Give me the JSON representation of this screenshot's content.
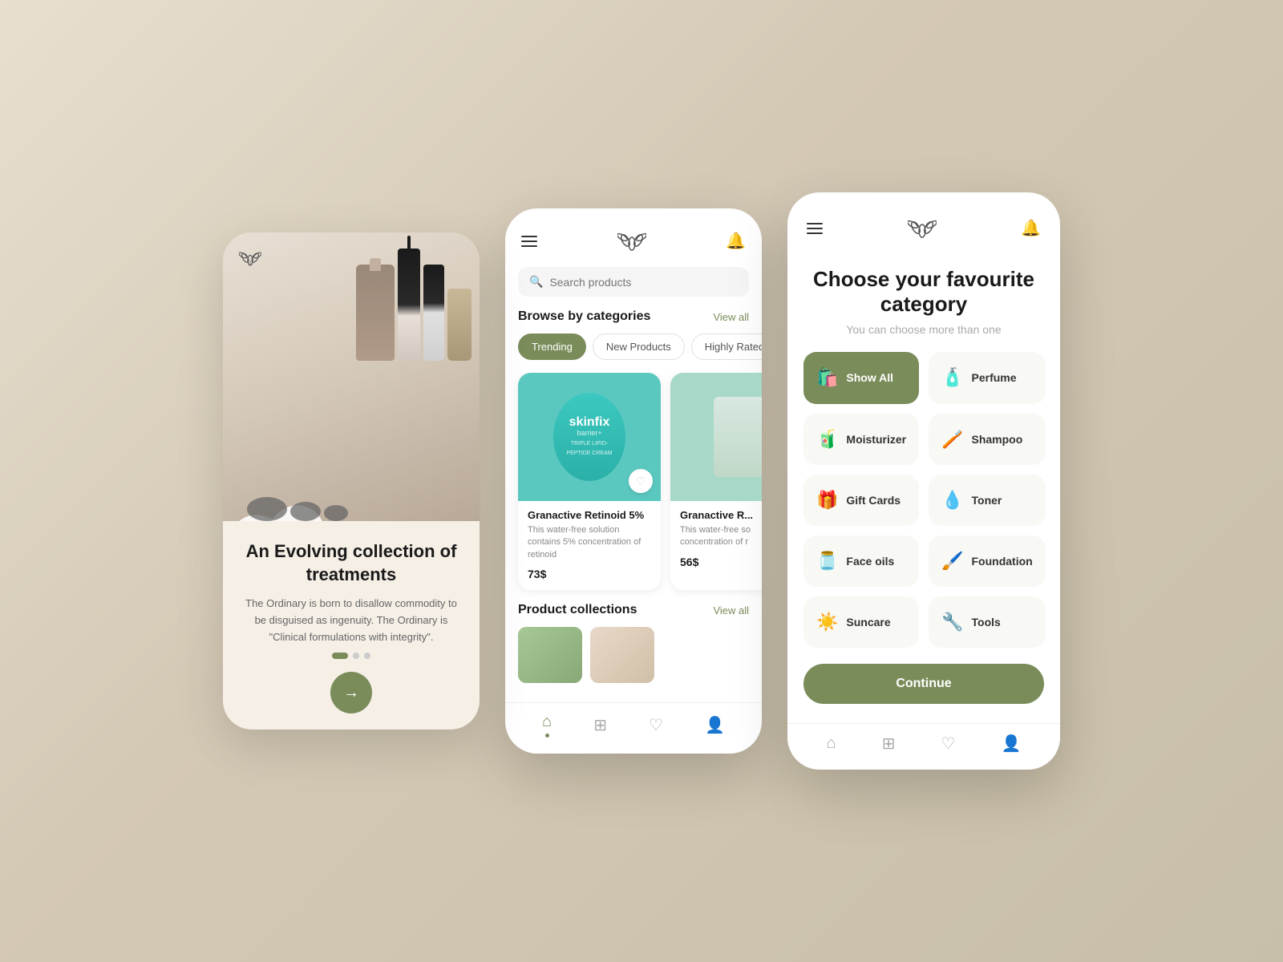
{
  "screen1": {
    "title": "An Evolving collection of treatments",
    "description": "The Ordinary is born to disallow commodity to be disguised as ingenuity. The Ordinary is \"Clinical formulations with integrity\".",
    "arrow_label": "→"
  },
  "screen2": {
    "header": {
      "logo_aria": "logo",
      "menu_aria": "menu",
      "bell_aria": "notifications"
    },
    "search": {
      "placeholder": "Search products"
    },
    "browse": {
      "title": "Browse by categories",
      "view_all": "View all"
    },
    "tabs": [
      {
        "label": "Trending",
        "active": true
      },
      {
        "label": "New Products",
        "active": false
      },
      {
        "label": "Highly Rated",
        "active": false
      }
    ],
    "products": [
      {
        "name": "Granactive Retinoid 5%",
        "description": "This water-free solution contains 5% concentration of retinoid",
        "price": "73$",
        "brand": "skinfix",
        "brand_sub": "barrier+"
      },
      {
        "name": "Granactive R...",
        "description": "This water-free so concentration of r",
        "price": "56$"
      }
    ],
    "collections": {
      "title": "Product collections",
      "view_all": "View all"
    },
    "nav": [
      {
        "icon": "home",
        "active": true
      },
      {
        "icon": "grid",
        "active": false
      },
      {
        "icon": "heart",
        "active": false
      },
      {
        "icon": "user",
        "active": false
      }
    ]
  },
  "screen3": {
    "title": "Choose your favourite category",
    "subtitle": "You can choose more than one",
    "categories": [
      {
        "label": "Show All",
        "emoji": "🛍️",
        "active": true
      },
      {
        "label": "Perfume",
        "emoji": "🧴",
        "active": false
      },
      {
        "label": "Moisturizer",
        "emoji": "🧃",
        "active": false
      },
      {
        "label": "Shampoo",
        "emoji": "🧴",
        "active": false
      },
      {
        "label": "Gift Cards",
        "emoji": "🎁",
        "active": false
      },
      {
        "label": "Toner",
        "emoji": "💧",
        "active": false
      },
      {
        "label": "Face oils",
        "emoji": "🫙",
        "active": false
      },
      {
        "label": "Foundation",
        "emoji": "🖌️",
        "active": false
      },
      {
        "label": "Suncare",
        "emoji": "☀️",
        "active": false
      },
      {
        "label": "Tools",
        "emoji": "🔧",
        "active": false
      }
    ],
    "continue_btn": "Continue",
    "nav": [
      {
        "icon": "home",
        "active": false
      },
      {
        "icon": "grid",
        "active": false
      },
      {
        "icon": "heart",
        "active": false
      },
      {
        "icon": "user",
        "active": false
      }
    ]
  }
}
